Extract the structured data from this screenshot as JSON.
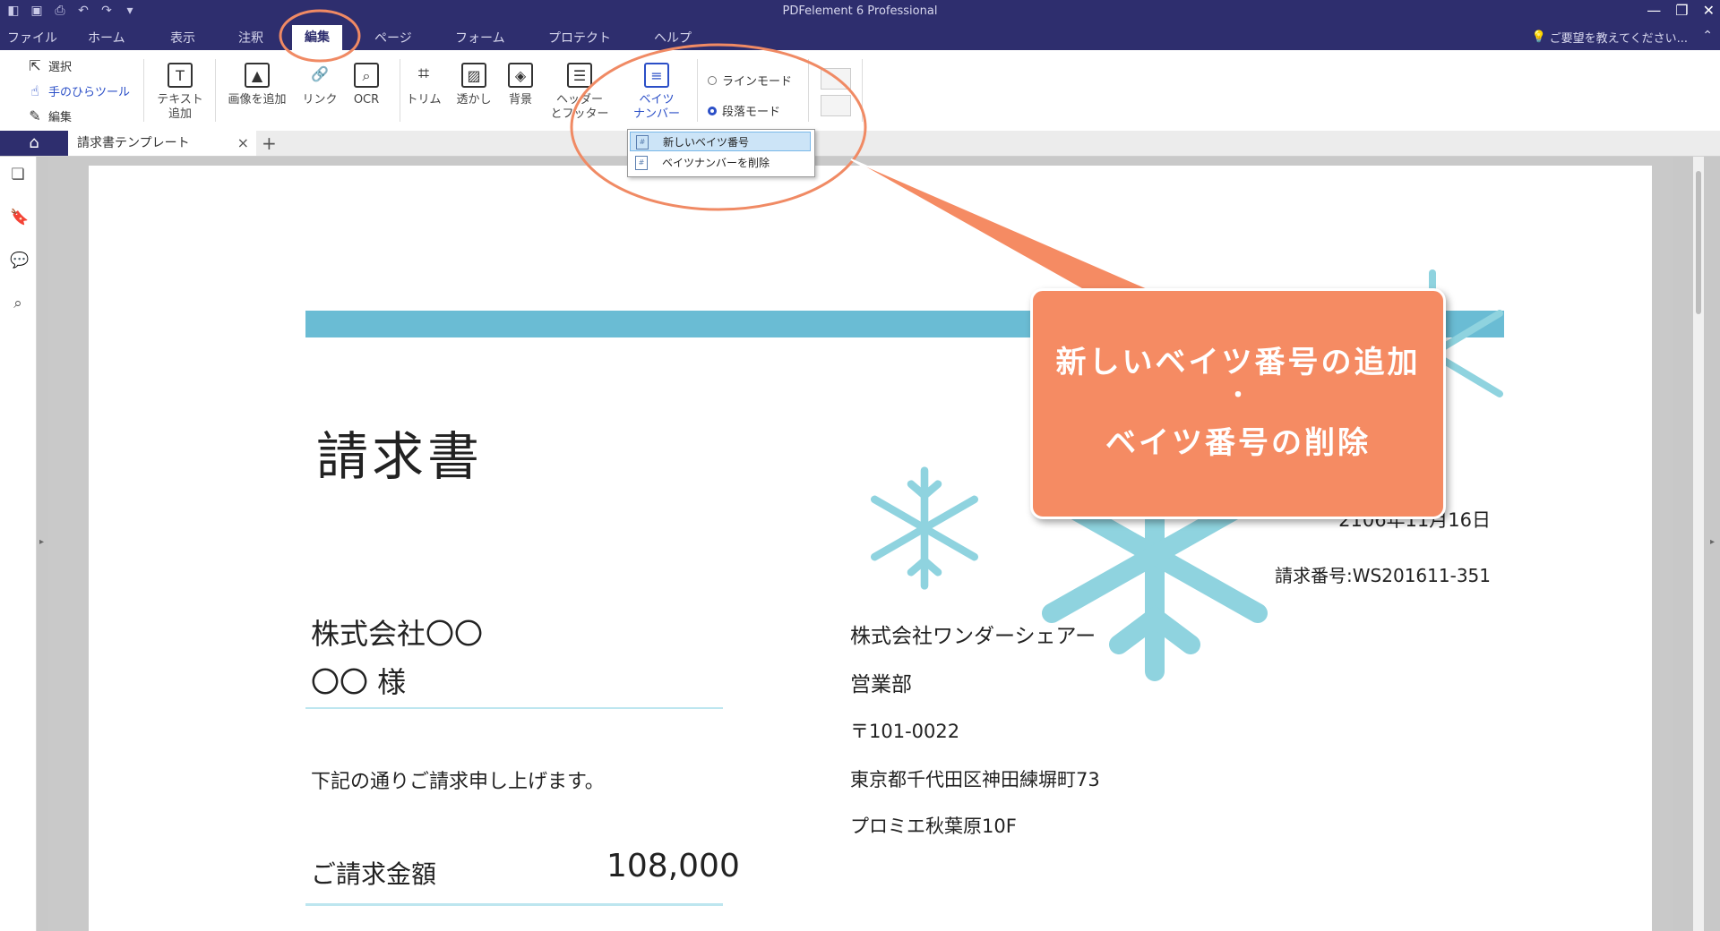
{
  "app": {
    "title": "PDFelement 6 Professional",
    "help_placeholder": "ご要望を教えてください..."
  },
  "menu": {
    "tabs": [
      "ファイル",
      "ホーム",
      "表示",
      "注釈",
      "編集",
      "ページ",
      "フォーム",
      "プロテクト",
      "ヘルプ"
    ],
    "active": "編集"
  },
  "ribbon": {
    "select": "選択",
    "hand_tool": "手のひらツール",
    "edit": "編集",
    "text_add_1": "テキスト",
    "text_add_2": "追加",
    "add_image": "画像を追加",
    "link": "リンク",
    "ocr": "OCR",
    "trim": "トリム",
    "watermark": "透かし",
    "background": "背景",
    "header_footer_1": "ヘッダー",
    "header_footer_2": "とフッター",
    "bates_1": "ベイツ",
    "bates_2": "ナンバー",
    "line_mode": "ラインモード",
    "paragraph_mode": "段落モード"
  },
  "dropdown": {
    "items": [
      "新しいベイツ番号",
      "ベイツナンバーを削除"
    ]
  },
  "tabs": {
    "document": "請求書テンプレート"
  },
  "document": {
    "title": "請求書",
    "date": "2106年11月16日",
    "invoice_no": "請求番号:WS201611-351",
    "customer_company": "株式会社〇〇",
    "customer_name": "〇〇 様",
    "sender_company": "株式会社ワンダーシェアー",
    "department": "営業部",
    "postal": "〒101-0022",
    "address": "東京都千代田区神田練塀町73",
    "building": "プロミエ秋葉原10F",
    "greeting": "下記の通りご請求申し上げます。",
    "amount_label": "ご請求金額",
    "amount_value": "108,000"
  },
  "callout": {
    "line1": "新しいベイツ番号の追加",
    "line2": "・",
    "line3": "ベイツ番号の削除"
  },
  "colors": {
    "titlebar": "#2e2e6e",
    "accent_blue": "#2b4fc7",
    "callout": "#f58b63",
    "highlight_circle": "#f08a64",
    "doc_bar": "#6abcd4"
  }
}
